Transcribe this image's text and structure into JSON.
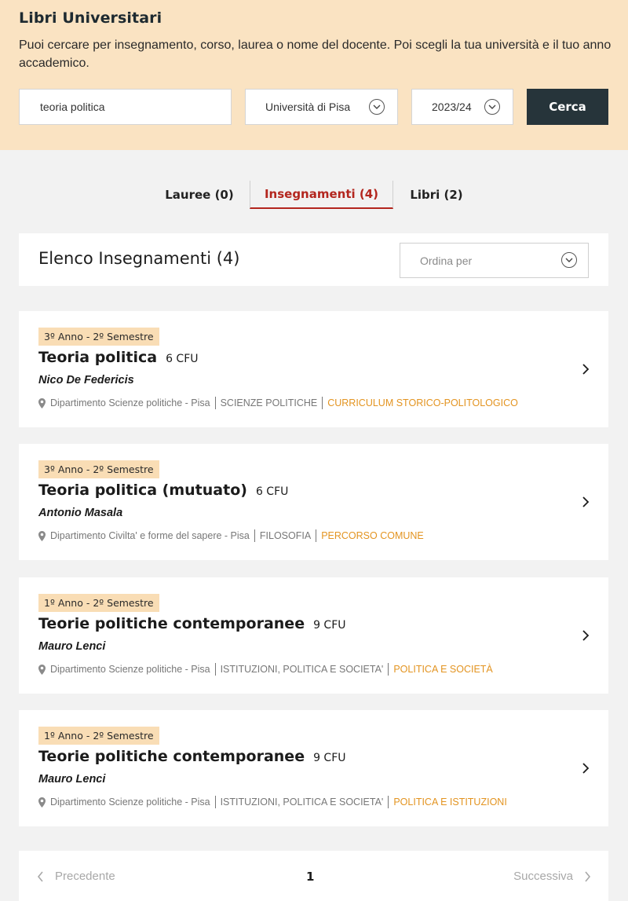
{
  "hero": {
    "title": "Libri Universitari",
    "description": "Puoi cercare per insegnamento, corso, laurea o nome del docente. Poi scegli la tua università e il tuo anno accademico.",
    "search_value": "teoria politica",
    "university": "Università di Pisa",
    "year": "2023/24",
    "search_button": "Cerca"
  },
  "tabs": [
    {
      "label": "Lauree (0)",
      "active": false
    },
    {
      "label": "Insegnamenti (4)",
      "active": true
    },
    {
      "label": "Libri (2)",
      "active": false
    }
  ],
  "list": {
    "title": "Elenco Insegnamenti (4)",
    "sort_placeholder": "Ordina per"
  },
  "courses": [
    {
      "period": "3º Anno - 2º Semestre",
      "name": "Teoria politica",
      "cfu": "6 CFU",
      "teacher": "Nico De Federicis",
      "department": "Dipartimento Scienze politiche - Pisa",
      "degree": "SCIENZE POLITICHE",
      "curriculum": "CURRICULUM STORICO-POLITOLOGICO"
    },
    {
      "period": "3º Anno - 2º Semestre",
      "name": "Teoria politica (mutuato)",
      "cfu": "6 CFU",
      "teacher": "Antonio Masala",
      "department": "Dipartimento Civilta' e forme del sapere - Pisa",
      "degree": "FILOSOFIA",
      "curriculum": "PERCORSO COMUNE"
    },
    {
      "period": "1º Anno - 2º Semestre",
      "name": "Teorie politiche contemporanee",
      "cfu": "9 CFU",
      "teacher": "Mauro Lenci",
      "department": "Dipartimento Scienze politiche - Pisa",
      "degree": "ISTITUZIONI, POLITICA E SOCIETA'",
      "curriculum": "POLITICA E SOCIETÀ"
    },
    {
      "period": "1º Anno - 2º Semestre",
      "name": "Teorie politiche contemporanee",
      "cfu": "9 CFU",
      "teacher": "Mauro Lenci",
      "department": "Dipartimento Scienze politiche - Pisa",
      "degree": "ISTITUZIONI, POLITICA E SOCIETA'",
      "curriculum": "POLITICA E ISTITUZIONI"
    }
  ],
  "pagination": {
    "prev": "Precedente",
    "current": "1",
    "next": "Successiva"
  },
  "colors": {
    "hero_bg": "#fae3c2",
    "badge_bg": "#f9ddb5",
    "active_tab": "#b3261e",
    "accent": "#e39421",
    "button_bg": "#26343a"
  }
}
